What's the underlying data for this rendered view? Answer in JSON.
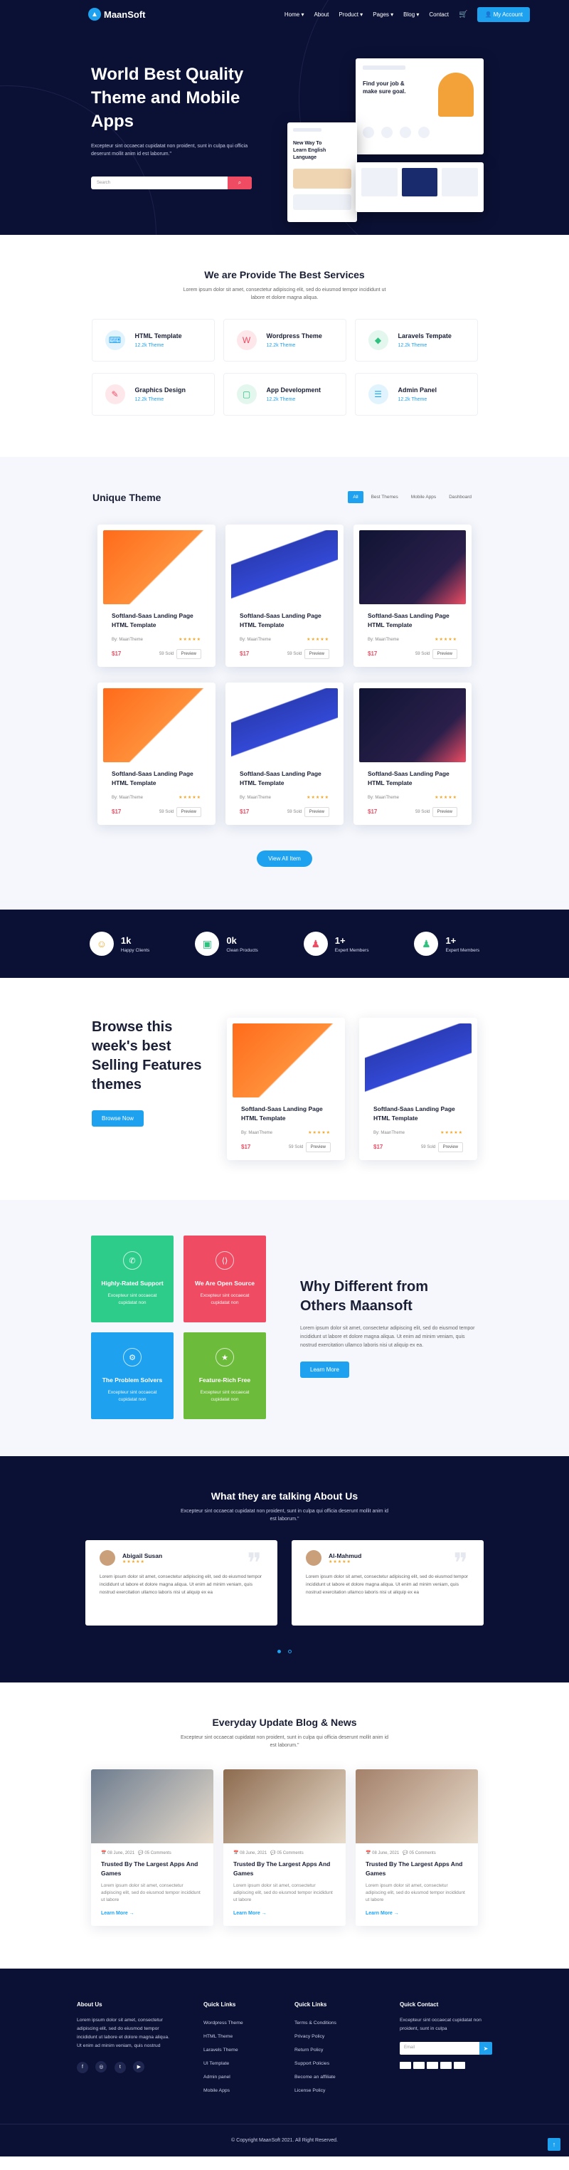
{
  "header": {
    "logo": "MaanSoft",
    "nav": [
      "Home",
      "About",
      "Product",
      "Pages",
      "Blog",
      "Contact"
    ],
    "account_button": "My Account"
  },
  "hero": {
    "title": "World Best Quality Theme and Mobile Apps",
    "text": "Excepteur sint occaecat cupidatat non proident, sunt in culpa qui officia deserunt mollit anim id est laborum.\"",
    "search_placeholder": "Search",
    "mock_tag": "Find your job & make sure goal.",
    "mock_learn": "New Way To Learn English Language"
  },
  "services": {
    "title": "We are Provide The Best Services",
    "subtitle": "Lorem ipsum dolor sit amet, consectetur adipiscing elit, sed do eiusmod tempor incididunt ut labore et dolore magna aliqua.",
    "items": [
      {
        "name": "HTML Template",
        "sub": "12.2k Theme",
        "icon": "html-icon",
        "color": "#1ea2f0"
      },
      {
        "name": "Wordpress Theme",
        "sub": "12.2k Theme",
        "icon": "wordpress-icon",
        "color": "#ef4c63"
      },
      {
        "name": "Laravels Tempate",
        "sub": "12.2k Theme",
        "icon": "laravel-icon",
        "color": "#2ec27e"
      },
      {
        "name": "Graphics Design",
        "sub": "12.2k Theme",
        "icon": "design-icon",
        "color": "#ef4c63"
      },
      {
        "name": "App Development",
        "sub": "12.2k Theme",
        "icon": "app-icon",
        "color": "#2ec27e"
      },
      {
        "name": "Admin Panel",
        "sub": "12.2k Theme",
        "icon": "admin-icon",
        "color": "#1ea2f0"
      }
    ]
  },
  "unique": {
    "title": "Unique Theme",
    "tabs": [
      "All",
      "Best Themes",
      "Mobile Apps",
      "Dashboard"
    ],
    "cards": [
      {
        "title": "Softland-Saas Landing Page HTML Template",
        "by": "By: MaanTheme",
        "price": "$17",
        "sold": "59 Sold",
        "preview": "Preview",
        "img": "im-orange"
      },
      {
        "title": "Softland-Saas Landing Page HTML Template",
        "by": "By: MaanTheme",
        "price": "$17",
        "sold": "59 Sold",
        "preview": "Preview",
        "img": "im-blue"
      },
      {
        "title": "Softland-Saas Landing Page HTML Template",
        "by": "By: MaanTheme",
        "price": "$17",
        "sold": "59 Sold",
        "preview": "Preview",
        "img": "im-dark"
      },
      {
        "title": "Softland-Saas Landing Page HTML Template",
        "by": "By: MaanTheme",
        "price": "$17",
        "sold": "59 Sold",
        "preview": "Preview",
        "img": "im-orange"
      },
      {
        "title": "Softland-Saas Landing Page HTML Template",
        "by": "By: MaanTheme",
        "price": "$17",
        "sold": "59 Sold",
        "preview": "Preview",
        "img": "im-blue"
      },
      {
        "title": "Softland-Saas Landing Page HTML Template",
        "by": "By: MaanTheme",
        "price": "$17",
        "sold": "59 Sold",
        "preview": "Preview",
        "img": "im-dark"
      }
    ],
    "view_all": "View All Item"
  },
  "stats": [
    {
      "num": "1k",
      "label": "Happy Clients",
      "icon": "smile-icon"
    },
    {
      "num": "0k",
      "label": "Clean Products",
      "icon": "product-icon"
    },
    {
      "num": "1+",
      "label": "Expert Members",
      "icon": "member-icon"
    },
    {
      "num": "1+",
      "label": "Expert Members",
      "icon": "member-icon"
    }
  ],
  "browse": {
    "title": "Browse this week's best Selling Features themes",
    "button": "Browse Now",
    "cards": [
      {
        "title": "Softland-Saas Landing Page HTML Template",
        "by": "By: MaanTheme",
        "price": "$17",
        "sold": "59 Sold",
        "preview": "Preview",
        "img": "im-orange"
      },
      {
        "title": "Softland-Saas Landing Page HTML Template",
        "by": "By: MaanTheme",
        "price": "$17",
        "sold": "59 Sold",
        "preview": "Preview",
        "img": "im-blue"
      }
    ]
  },
  "why": {
    "features": [
      {
        "title": "Highly-Rated Support",
        "text": "Excepteur sint occaecat cupidatat non",
        "color": "#2ecc8a"
      },
      {
        "title": "We Are Open Source",
        "text": "Excepteur sint occaecat cupidatat non",
        "color": "#ef4c63"
      },
      {
        "title": "The Problem Solvers",
        "text": "Excepteur sint occaecat cupidatat non",
        "color": "#1ea2f0"
      },
      {
        "title": "Feature-Rich Free",
        "text": "Excepteur sint occaecat cupidatat non",
        "color": "#6dbb3a"
      }
    ],
    "title": "Why Different from Others Maansoft",
    "text": "Lorem ipsum dolor sit amet, consectetur adipiscing elit, sed do eiusmod tempor incididunt ut labore et dolore magna aliqua. Ut enim ad minim veniam, quis nostrud exercitation ullamco laboris nisi ut aliquip ex ea.",
    "button": "Learn More"
  },
  "testimonials": {
    "title": "What they are talking About Us",
    "subtitle": "Excepteur sint occaecat cupidatat non proident, sunt in culpa qui officia deserunt mollit anim id est laborum.\"",
    "items": [
      {
        "name": "Abigail Susan",
        "text": "Lorem ipsum dolor sit amet, consectetur adipiscing elit, sed do eiusmod tempor incididunt ut labore et dolore magna aliqua. Ut enim ad minim veniam, quis nostrud exercitation ullamco laboris nisi ut aliquip ex ea"
      },
      {
        "name": "Al-Mahmud",
        "text": "Lorem ipsum dolor sit amet, consectetur adipiscing elit, sed do eiusmod tempor incididunt ut labore et dolore magna aliqua. Ut enim ad minim veniam, quis nostrud exercitation ullamco laboris nisi ut aliquip ex ea"
      }
    ]
  },
  "blog": {
    "title": "Everyday Update Blog & News",
    "subtitle": "Excepteur sint occaecat cupidatat non proident, sunt in culpa qui officia deserunt mollit anim id est laborum.\"",
    "posts": [
      {
        "date": "08 June, 2021",
        "comments": "05 Comments",
        "title": "Trusted By The Largest Apps And Games",
        "text": "Lorem ipsum dolor sit amet, consectetur adipiscing elit, sed do eiusmod tempor incididunt ut labore",
        "more": "Learn More",
        "color": "#6d7c8f"
      },
      {
        "date": "08 June, 2021",
        "comments": "05 Comments",
        "title": "Trusted By The Largest Apps And Games",
        "text": "Lorem ipsum dolor sit amet, consectetur adipiscing elit, sed do eiusmod tempor incididunt ut labore",
        "more": "Learn More",
        "color": "#8d6b4f"
      },
      {
        "date": "08 June, 2021",
        "comments": "05 Comments",
        "title": "Trusted By The Largest Apps And Games",
        "text": "Lorem ipsum dolor sit amet, consectetur adipiscing elit, sed do eiusmod tempor incididunt ut labore",
        "more": "Learn More",
        "color": "#a4816a"
      }
    ]
  },
  "footer": {
    "about_title": "About Us",
    "about_text": "Lorem ipsum dolor sit amet, consectetur adipiscing elit, sed do eiusmod tempor incididunt ut labore et dolore magna aliqua. Ut enim ad minim veniam, quis nostrud",
    "quick1_title": "Quick Links",
    "quick1": [
      "Wordpress Theme",
      "HTML Theme",
      "Laravels Theme",
      "UI Template",
      "Admin panel",
      "Mobile Apps"
    ],
    "quick2_title": "Quick Links",
    "quick2": [
      "Terms & Conditions",
      "Privacy Policy",
      "Return Policy",
      "Support Policies",
      "Become an affiliate",
      "License Policy"
    ],
    "contact_title": "Quick Contact",
    "contact_text": "Excepteur sint occaecat cupidatat non proident, sunt in culpa",
    "email_placeholder": "Email",
    "copyright": "© Copyright MaanSoft 2021. All Right Reserved."
  }
}
